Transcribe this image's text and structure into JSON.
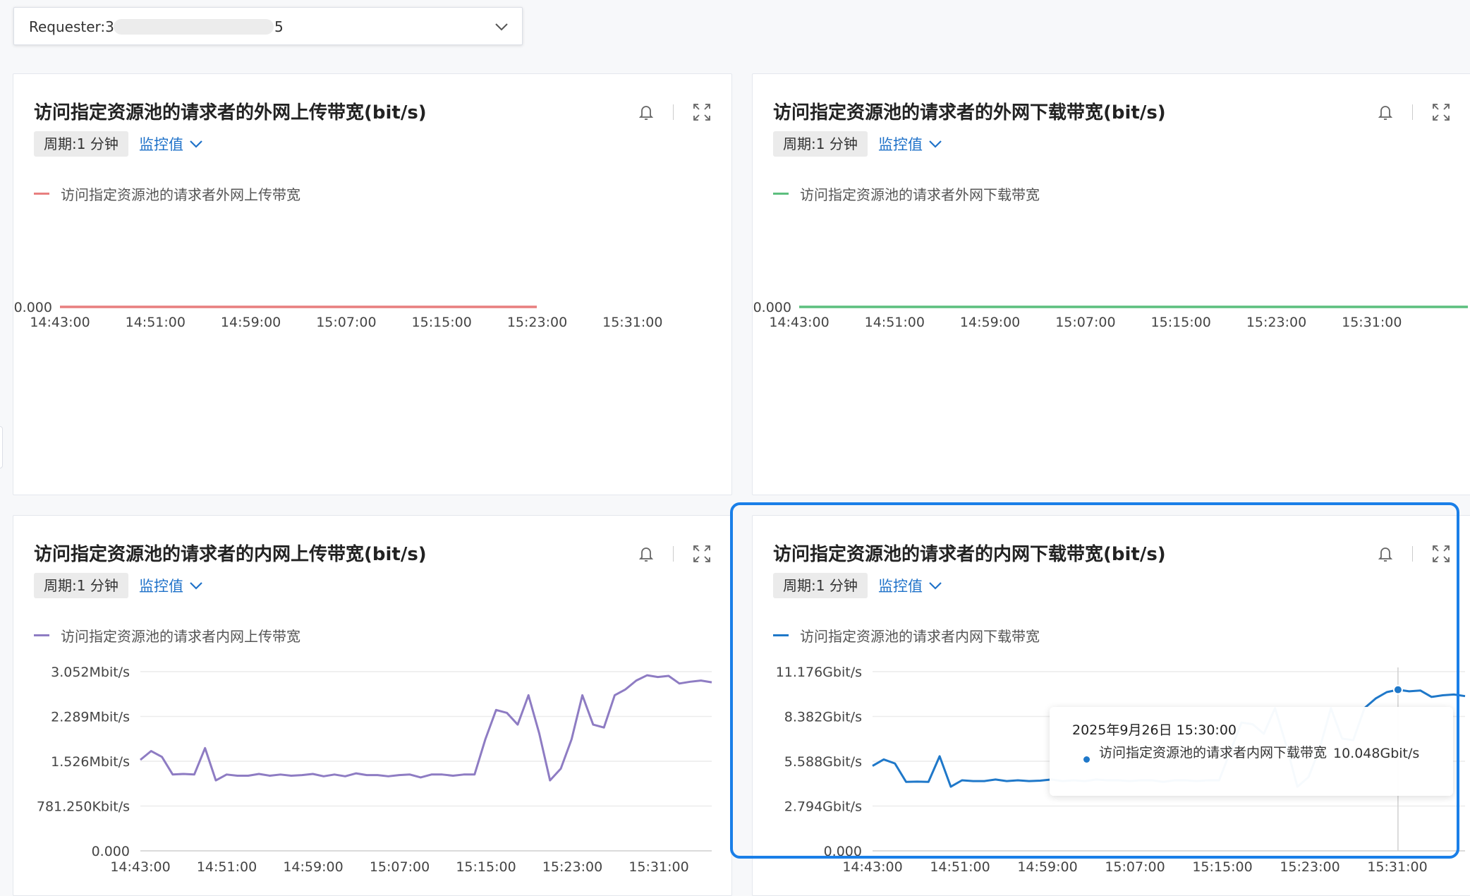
{
  "requester": {
    "prefix": "Requester:3",
    "suffix": "5"
  },
  "panels": [
    {
      "title": "访问指定资源池的请求者的外网上传带宽(bit/s)",
      "period": "周期:1 分钟",
      "metric": "监控值",
      "legend": "访问指定资源池的请求者外网上传带宽",
      "color": "#e87f7f"
    },
    {
      "title": "访问指定资源池的请求者的外网下载带宽(bit/s)",
      "period": "周期:1 分钟",
      "metric": "监控值",
      "legend": "访问指定资源池的请求者外网下载带宽",
      "color": "#5cbf7e"
    },
    {
      "title": "访问指定资源池的请求者的内网上传带宽(bit/s)",
      "period": "周期:1 分钟",
      "metric": "监控值",
      "legend": "访问指定资源池的请求者内网上传带宽",
      "color": "#8e7cc3"
    },
    {
      "title": "访问指定资源池的请求者的内网下载带宽(bit/s)",
      "period": "周期:1 分钟",
      "metric": "监控值",
      "legend": "访问指定资源池的请求者内网下载带宽",
      "color": "#1f78c9"
    }
  ],
  "tooltip": {
    "time": "2025年9月26日 15:30:00",
    "series": "访问指定资源池的请求者内网下载带宽",
    "value": "10.048Gbit/s"
  },
  "chart_data": [
    {
      "type": "line",
      "x": [
        "14:43:00",
        "14:51:00",
        "14:59:00",
        "15:07:00",
        "15:15:00",
        "15:23:00",
        "15:31:00"
      ],
      "y_ticks": [
        "0.000"
      ],
      "series": [
        {
          "name": "访问指定资源池的请求者外网上传带宽",
          "values": [
            0,
            0,
            0,
            0,
            0,
            0,
            0
          ]
        }
      ]
    },
    {
      "type": "line",
      "x": [
        "14:43:00",
        "14:51:00",
        "14:59:00",
        "15:07:00",
        "15:15:00",
        "15:23:00",
        "15:31:00"
      ],
      "y_ticks": [
        "0.000"
      ],
      "series": [
        {
          "name": "访问指定资源池的请求者外网下载带宽",
          "values": [
            0,
            0,
            0,
            0,
            0,
            0,
            0
          ]
        }
      ]
    },
    {
      "type": "line",
      "x": [
        "14:43:00",
        "14:51:00",
        "14:59:00",
        "15:07:00",
        "15:15:00",
        "15:23:00",
        "15:31:00"
      ],
      "y_ticks": [
        "0.000",
        "781.250Kbit/s",
        "1.526Mbit/s",
        "2.289Mbit/s",
        "3.052Mbit/s"
      ],
      "unit": "Mbit/s",
      "ylim": [
        0,
        3.052
      ],
      "start_minute": 0,
      "series": [
        {
          "name": "访问指定资源池的请求者内网上传带宽",
          "values": [
            1.55,
            1.7,
            1.6,
            1.3,
            1.31,
            1.3,
            1.75,
            1.2,
            1.3,
            1.28,
            1.28,
            1.31,
            1.28,
            1.3,
            1.28,
            1.29,
            1.31,
            1.27,
            1.3,
            1.27,
            1.32,
            1.29,
            1.29,
            1.27,
            1.29,
            1.3,
            1.25,
            1.3,
            1.3,
            1.28,
            1.3,
            1.3,
            1.9,
            2.4,
            2.35,
            2.15,
            2.65,
            2.0,
            1.2,
            1.4,
            1.9,
            2.65,
            2.15,
            2.1,
            2.65,
            2.75,
            2.9,
            2.99,
            2.96,
            2.98,
            2.85,
            2.88,
            2.9,
            2.87
          ]
        }
      ]
    },
    {
      "type": "line",
      "x": [
        "14:43:00",
        "14:51:00",
        "14:59:00",
        "15:07:00",
        "15:15:00",
        "15:23:00",
        "15:31:00"
      ],
      "y_ticks": [
        "0.000",
        "2.794Gbit/s",
        "5.588Gbit/s",
        "8.382Gbit/s",
        "11.176Gbit/s"
      ],
      "unit": "Gbit/s",
      "ylim": [
        0,
        11.176
      ],
      "start_minute": 0,
      "series": [
        {
          "name": "访问指定资源池的请求者内网下载带宽",
          "values": [
            5.3,
            5.7,
            5.45,
            4.3,
            4.32,
            4.3,
            5.9,
            4.0,
            4.4,
            4.35,
            4.35,
            4.45,
            4.35,
            4.4,
            4.35,
            4.38,
            4.45,
            4.35,
            4.4,
            4.35,
            4.45,
            4.4,
            4.4,
            4.35,
            4.4,
            4.4,
            4.3,
            4.4,
            4.4,
            4.35,
            4.4,
            4.4,
            6.2,
            8.0,
            7.9,
            7.3,
            8.9,
            6.6,
            4.0,
            4.6,
            6.4,
            8.9,
            7.0,
            6.9,
            8.9,
            9.5,
            9.9,
            10.048,
            9.95,
            10.0,
            9.6,
            9.7,
            9.75,
            9.65
          ]
        }
      ]
    }
  ]
}
